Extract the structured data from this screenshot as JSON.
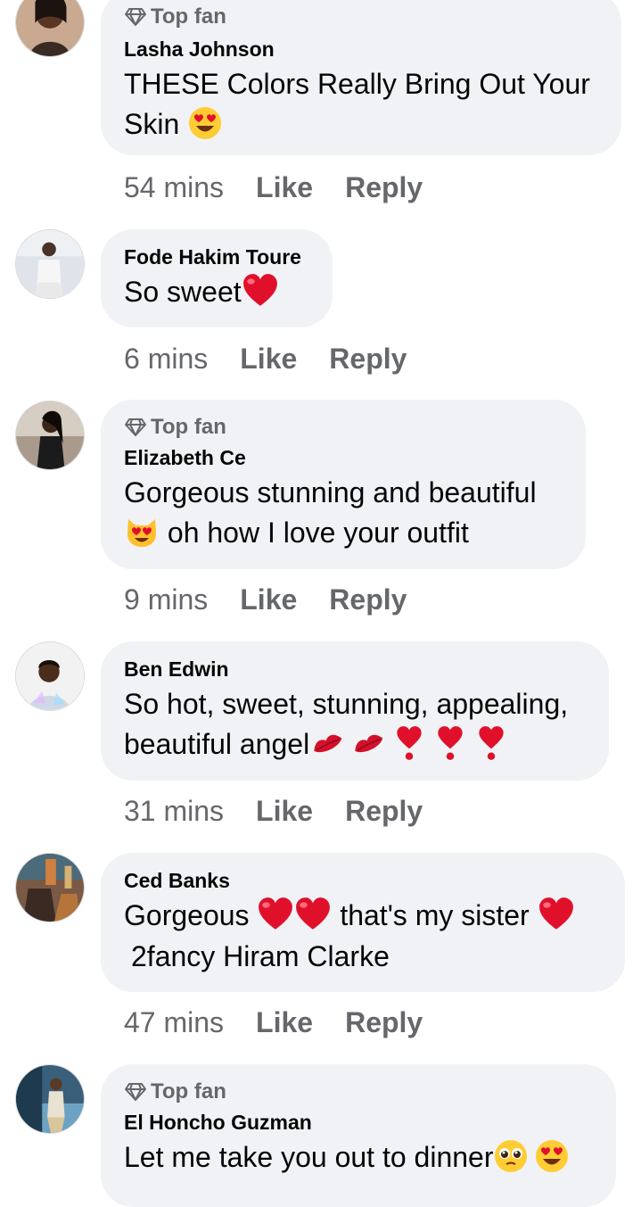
{
  "badge_label": "Top fan",
  "like_label": "Like",
  "reply_label": "Reply",
  "comments": [
    {
      "author": "Lasha Johnson",
      "line1": "THESE Colors Really Bring Out Your",
      "line2": "Skin",
      "time": "54 mins"
    },
    {
      "author": "Fode Hakim Toure",
      "line1": "So sweet",
      "time": "6 mins"
    },
    {
      "author": "Elizabeth Ce",
      "line1": "Gorgeous stunning and beautiful",
      "line2": "oh how I love your outfit",
      "time": "9 mins"
    },
    {
      "author": "Ben Edwin",
      "line1": "So hot, sweet, stunning, appealing,",
      "line2": "beautiful angel",
      "time": "31 mins"
    },
    {
      "author": "Ced Banks",
      "line1a": "Gorgeous",
      "line1b": "that's my sister",
      "line2": "2fancy Hiram Clarke",
      "time": "47 mins"
    },
    {
      "author": "El Honcho Guzman",
      "line1": "Let me take you out to dinner"
    }
  ],
  "icons": {
    "heart_eyes": "heart-eyes-emoji",
    "heart": "red-heart-emoji",
    "heart_eyes_cat": "heart-eyes-cat-emoji",
    "kiss": "kiss-mark-emoji",
    "exclamation_heart": "heart-exclamation-emoji",
    "pleading": "pleading-face-emoji",
    "top_fan": "diamond-icon"
  }
}
